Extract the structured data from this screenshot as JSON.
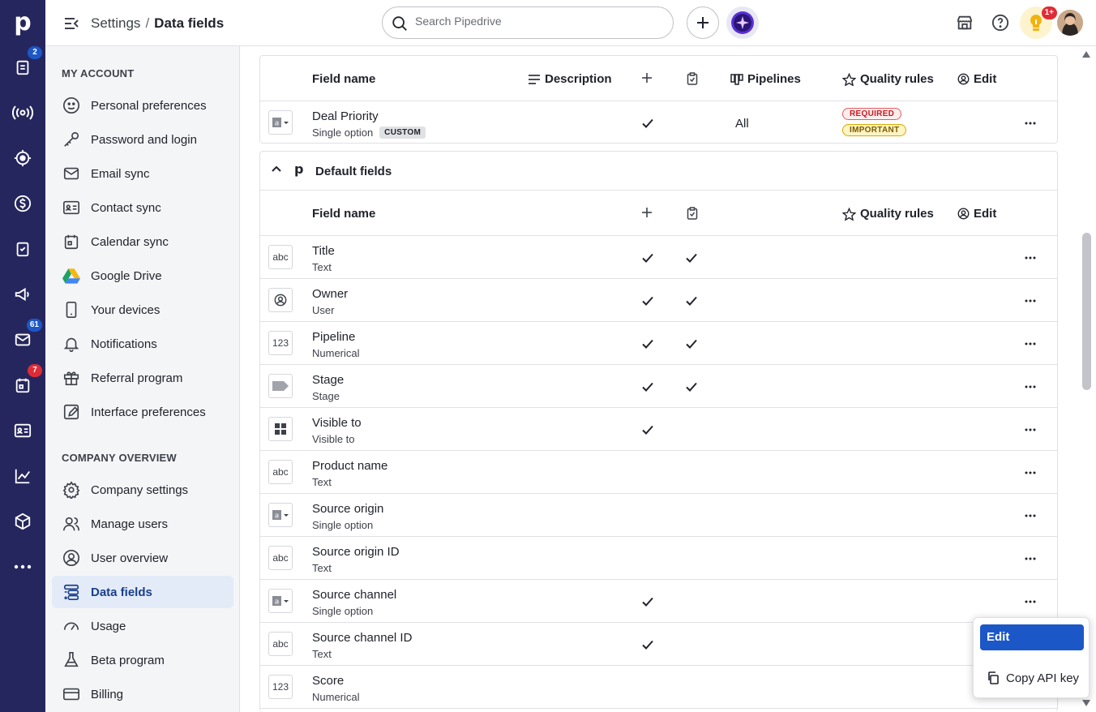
{
  "rail": {
    "logo": "p",
    "badges": {
      "activities": "2",
      "mail": "61",
      "calendar": "7"
    },
    "badge_color": "#1c57c7",
    "badge_color_alert": "#e02b36"
  },
  "header": {
    "breadcrumb_section": "Settings",
    "breadcrumb_sep": "/",
    "breadcrumb_current": "Data fields",
    "search_placeholder": "Search Pipedrive",
    "notif_badge": "1+"
  },
  "sidebar": {
    "section_account": "MY ACCOUNT",
    "account_items": [
      {
        "label": "Personal preferences"
      },
      {
        "label": "Password and login"
      },
      {
        "label": "Email sync"
      },
      {
        "label": "Contact sync"
      },
      {
        "label": "Calendar sync"
      },
      {
        "label": "Google Drive"
      },
      {
        "label": "Your devices"
      },
      {
        "label": "Notifications"
      },
      {
        "label": "Referral program"
      },
      {
        "label": "Interface preferences"
      }
    ],
    "section_company": "COMPANY OVERVIEW",
    "company_items": [
      {
        "label": "Company settings"
      },
      {
        "label": "Manage users"
      },
      {
        "label": "User overview"
      },
      {
        "label": "Data fields"
      },
      {
        "label": "Usage"
      },
      {
        "label": "Beta program"
      },
      {
        "label": "Billing"
      }
    ]
  },
  "custom_table": {
    "headers": {
      "field_name": "Field name",
      "description": "Description",
      "pipelines": "Pipelines",
      "quality_rules": "Quality rules",
      "edit": "Edit"
    },
    "row": {
      "name": "Deal Priority",
      "type": "Single option",
      "tag": "CUSTOM",
      "pipelines": "All",
      "rule_required": "REQUIRED",
      "rule_important": "IMPORTANT"
    }
  },
  "default_section": {
    "title": "Default fields",
    "headers": {
      "field_name": "Field name",
      "quality_rules": "Quality rules",
      "edit": "Edit"
    },
    "rows": [
      {
        "icon": "abc",
        "name": "Title",
        "type": "Text"
      },
      {
        "icon": "person",
        "name": "Owner",
        "type": "User"
      },
      {
        "icon": "123",
        "name": "Pipeline",
        "type": "Numerical"
      },
      {
        "icon": "stage",
        "name": "Stage",
        "type": "Stage"
      },
      {
        "icon": "grid",
        "name": "Visible to",
        "type": "Visible to"
      },
      {
        "icon": "abc",
        "name": "Product name",
        "type": "Text"
      },
      {
        "icon": "option",
        "name": "Source origin",
        "type": "Single option"
      },
      {
        "icon": "abc",
        "name": "Source origin ID",
        "type": "Text"
      },
      {
        "icon": "option",
        "name": "Source channel",
        "type": "Single option"
      },
      {
        "icon": "abc",
        "name": "Source channel ID",
        "type": "Text"
      },
      {
        "icon": "123",
        "name": "Score",
        "type": "Numerical"
      }
    ],
    "icon_abc": "abc",
    "icon_123": "123",
    "icon_a": "a"
  },
  "context_menu": {
    "edit": "Edit",
    "copy_api_key": "Copy API key"
  }
}
